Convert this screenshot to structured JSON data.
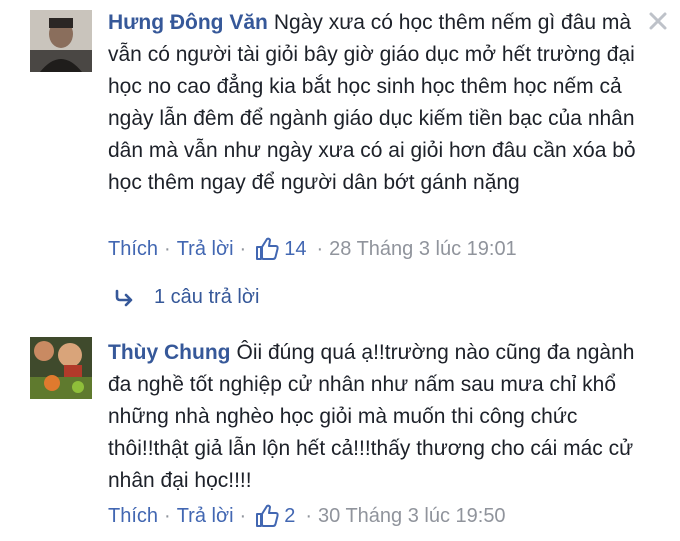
{
  "comments": [
    {
      "author": "Hưng Đông Văn",
      "text": "Ngày xưa có học thêm nếm gì đâu mà vẫn có người tài giỏi bây giờ giáo dục mở hết trường đại học no cao đẳng kia bắt học sinh học thêm học nếm cả ngày lẫn đêm để ngành giáo dục kiếm tiền bạc của nhân dân mà vẫn như ngày xưa có ai giỏi hơn đâu cần xóa bỏ học thêm ngay để người dân bớt gánh nặng",
      "like_label": "Thích",
      "reply_label": "Trả lời",
      "like_count": "14",
      "timestamp": "28 Tháng 3 lúc 19:01",
      "replies_label": "1 câu trả lời"
    },
    {
      "author": "Thùy Chung",
      "text": "Ôii đúng quá ạ!!trường nào cũng đa ngành đa nghề tốt nghiệp cử nhân như nấm sau mưa chỉ khổ những nhà nghèo học giỏi mà muốn thi công chức thôi!!thật giả lẫn lộn hết cả!!!thấy thương cho cái mác cử nhân đại học!!!!",
      "like_label": "Thích",
      "reply_label": "Trả lời",
      "like_count": "2",
      "timestamp": "30 Tháng 3 lúc 19:50"
    }
  ],
  "separator": "·",
  "icons": {
    "close": "close-icon",
    "like": "thumbs-up-icon",
    "reply": "reply-arrow-icon"
  },
  "colors": {
    "author": "#365899",
    "link": "#4267b2",
    "meta": "#90949c",
    "text": "#1d2129"
  }
}
